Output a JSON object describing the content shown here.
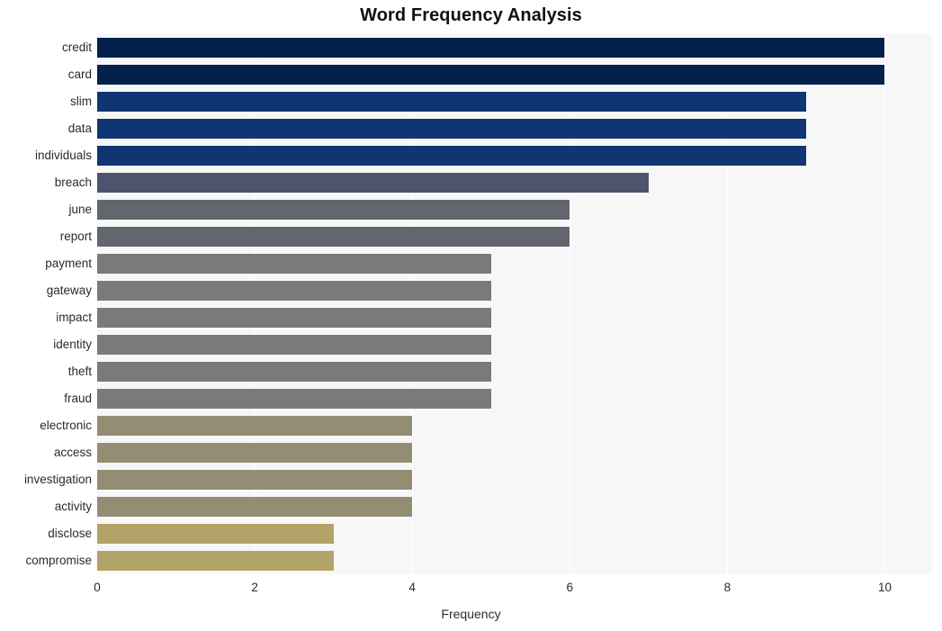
{
  "chart_data": {
    "type": "bar",
    "orientation": "horizontal",
    "title": "Word Frequency Analysis",
    "xlabel": "Frequency",
    "ylabel": "",
    "xlim": [
      0,
      10.6
    ],
    "xticks": [
      0,
      2,
      4,
      6,
      8,
      10
    ],
    "xtick_labels": [
      "0",
      "2",
      "4",
      "6",
      "8",
      "10"
    ],
    "grid": true,
    "grid_axis": "x",
    "legend": "none",
    "categories": [
      "credit",
      "card",
      "slim",
      "data",
      "individuals",
      "breach",
      "june",
      "report",
      "payment",
      "gateway",
      "impact",
      "identity",
      "theft",
      "fraud",
      "electronic",
      "access",
      "investigation",
      "activity",
      "disclose",
      "compromise"
    ],
    "values": [
      10,
      10,
      9,
      9,
      9,
      7,
      6,
      6,
      5,
      5,
      5,
      5,
      5,
      5,
      4,
      4,
      4,
      4,
      3,
      3
    ],
    "bar_colors": [
      "#04214d",
      "#04214d",
      "#0f3572",
      "#0f3572",
      "#0f3572",
      "#4d556e",
      "#63666f",
      "#63666f",
      "#7a7a78",
      "#7a7a78",
      "#7a7a78",
      "#7a7a78",
      "#7a7a78",
      "#7a7a78",
      "#938d74",
      "#938d74",
      "#938d74",
      "#938d74",
      "#b2a369",
      "#b2a369"
    ]
  },
  "style": {
    "figure_background": "#ffffff",
    "plot_background": "#f7f7f7",
    "gridline_color": "#ffffff",
    "title_color": "#111111",
    "tick_color": "#2b2b2b"
  }
}
